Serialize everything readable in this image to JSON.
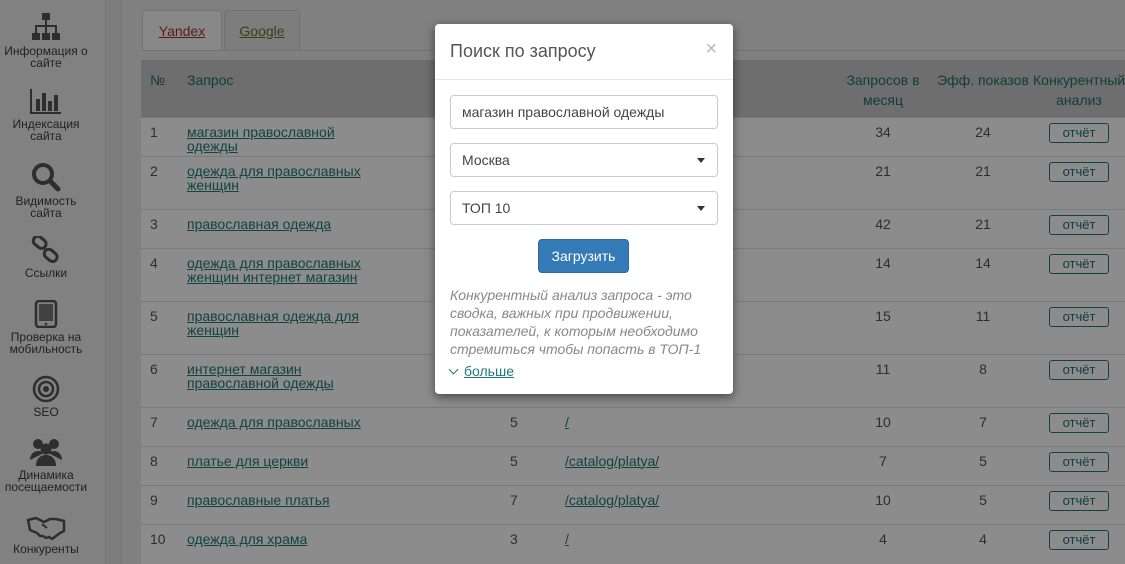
{
  "sidebar": {
    "items": [
      {
        "label": "Информация о сайте",
        "icon": "sitemap-icon"
      },
      {
        "label": "Индексация сайта",
        "icon": "bar-chart-icon"
      },
      {
        "label": "Видимость сайта",
        "icon": "search-icon"
      },
      {
        "label": "Ссылки",
        "icon": "link-icon"
      },
      {
        "label": "Проверка на мобильность",
        "icon": "tablet-icon"
      },
      {
        "label": "SEO",
        "icon": "target-icon"
      },
      {
        "label": "Динамика посещаемости",
        "icon": "users-icon"
      },
      {
        "label": "Конкуренты",
        "icon": "handshake-icon"
      }
    ]
  },
  "tabs": [
    {
      "label": "Yandex",
      "active": true
    },
    {
      "label": "Google",
      "active": false
    }
  ],
  "table": {
    "headers": {
      "num": "№",
      "query": "Запрос",
      "requests": "Запросов в месяц",
      "eff": "Эфф. показов",
      "competitive": "Конкурентный анализ"
    },
    "rows": [
      {
        "num": "1",
        "query": "магазин православной одежды",
        "pos": "",
        "url": "",
        "requests": "34",
        "eff": "24",
        "action": "отчёт"
      },
      {
        "num": "2",
        "query": "одежда для православных женщин",
        "pos": "",
        "url": "",
        "requests": "21",
        "eff": "21",
        "action": "отчёт"
      },
      {
        "num": "3",
        "query": "православная одежда",
        "pos": "",
        "url": "",
        "requests": "42",
        "eff": "21",
        "action": "отчёт"
      },
      {
        "num": "4",
        "query": "одежда для православных женщин интернет магазин",
        "pos": "",
        "url": "",
        "requests": "14",
        "eff": "14",
        "action": "отчёт"
      },
      {
        "num": "5",
        "query": "православная одежда для женщин",
        "pos": "",
        "url": "",
        "requests": "15",
        "eff": "11",
        "action": "отчёт"
      },
      {
        "num": "6",
        "query": "интернет магазин православной одежды",
        "pos": "",
        "url": "",
        "requests": "11",
        "eff": "8",
        "action": "отчёт"
      },
      {
        "num": "7",
        "query": "одежда для православных",
        "pos": "5",
        "url": "/",
        "requests": "10",
        "eff": "7",
        "action": "отчёт"
      },
      {
        "num": "8",
        "query": "платье для церкви",
        "pos": "5",
        "url": "/catalog/platya/",
        "requests": "7",
        "eff": "5",
        "action": "отчёт"
      },
      {
        "num": "9",
        "query": "православные платья",
        "pos": "7",
        "url": "/catalog/platya/",
        "requests": "10",
        "eff": "5",
        "action": "отчёт"
      },
      {
        "num": "10",
        "query": "одежда для храма",
        "pos": "3",
        "url": "/",
        "requests": "4",
        "eff": "4",
        "action": "отчёт"
      }
    ]
  },
  "modal": {
    "title": "Поиск по запросу",
    "close": "×",
    "query_value": "магазин православной одежды",
    "region": "Москва",
    "top": "ТОП 10",
    "load_button": "Загрузить",
    "description": "Конкурентный анализ запроса - это сводка, важных при продвижении, показателей, к которым необходимо стремиться чтобы попасть в ТОП-1",
    "more": "больше"
  }
}
